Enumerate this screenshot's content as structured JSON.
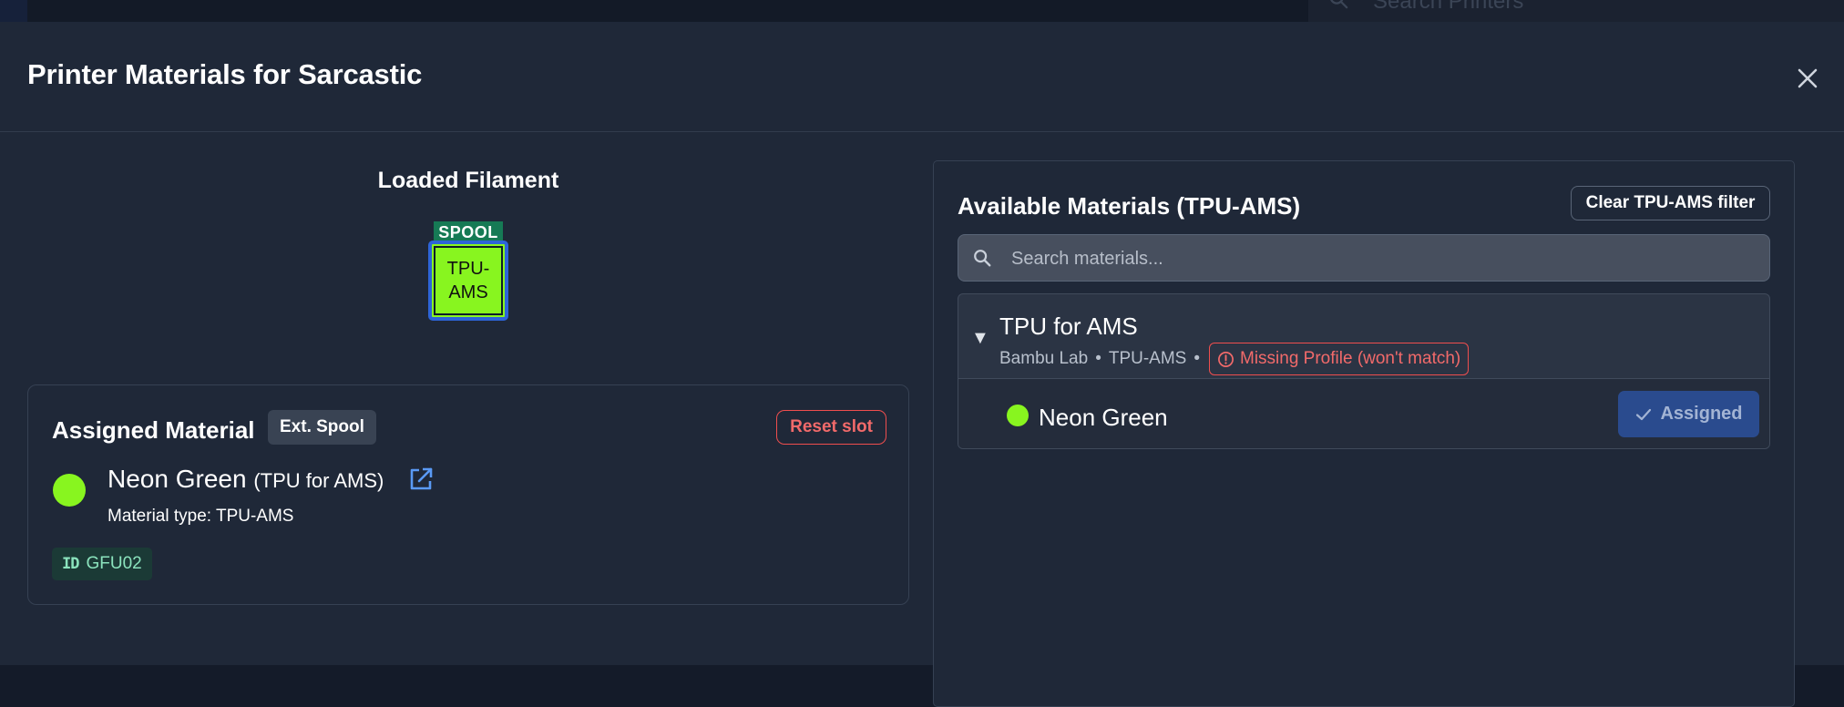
{
  "background": {
    "search_placeholder": "Search Printers"
  },
  "modal": {
    "title": "Printer Materials for Sarcastic",
    "close_icon": "close-icon"
  },
  "loaded": {
    "title": "Loaded Filament",
    "spool_tag": "SPOOL",
    "spool_label_line1": "TPU-",
    "spool_label_line2": "AMS",
    "spool_color": "#88f51f"
  },
  "assigned": {
    "title": "Assigned Material",
    "badge": "Ext. Spool",
    "reset_label": "Reset slot",
    "material_name": "Neon Green",
    "material_sub": "(TPU for AMS)",
    "material_type": "Material type: TPU-AMS",
    "id_icon": "ID",
    "id_value": "GFU02",
    "color": "#88f51f"
  },
  "available": {
    "title": "Available Materials (TPU-AMS)",
    "clear_filter_label": "Clear TPU-AMS filter",
    "search_placeholder": "Search materials...",
    "group": {
      "name": "TPU for AMS",
      "vendor": "Bambu Lab",
      "type": "TPU-AMS",
      "separator": "•",
      "missing_label": "Missing Profile (won't match)",
      "items": [
        {
          "name": "Neon Green",
          "color": "#88f51f",
          "action_label": "Assigned"
        }
      ]
    }
  },
  "colors": {
    "accent_blue": "#2d64d8",
    "danger_red": "#ef4e4e",
    "spool_green": "#167a55"
  }
}
